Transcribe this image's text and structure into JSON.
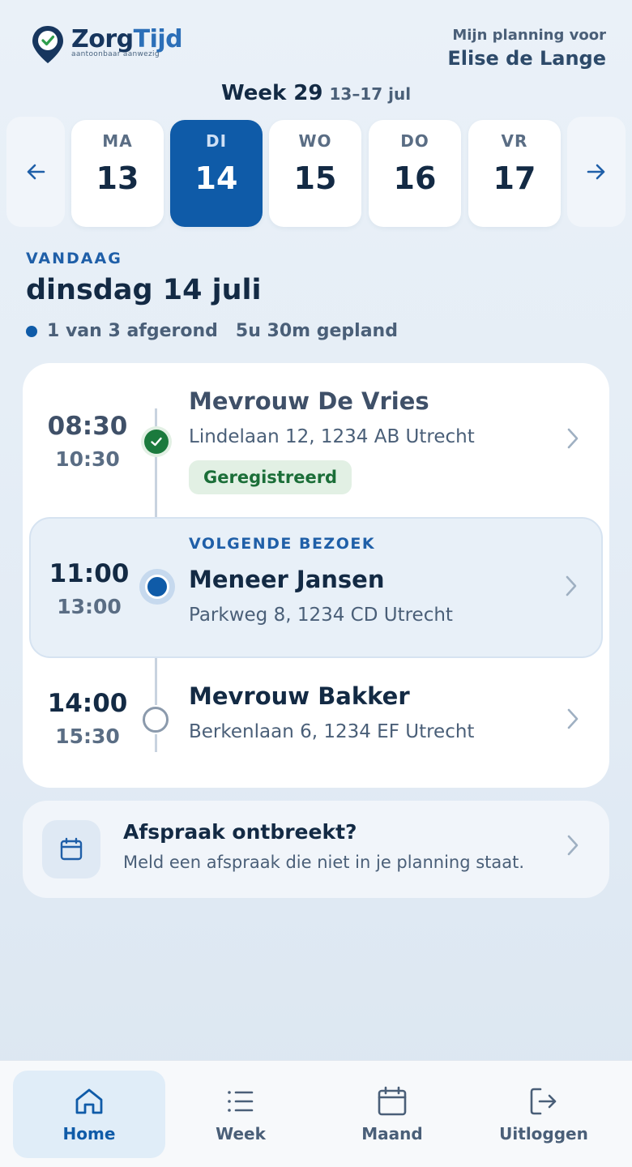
{
  "app": {
    "logo_name_part1": "Zorg",
    "logo_name_part2": "Tijd",
    "logo_tagline": "aantoonbaar aanwezig",
    "planning_label": "Mijn planning voor",
    "user_name": "Elise de Lange"
  },
  "week": {
    "title": "Week 29",
    "range": "13–17 jul",
    "prev_icon": "arrow-left-icon",
    "next_icon": "arrow-right-icon",
    "days": [
      {
        "name": "MA",
        "number": "13",
        "active": false
      },
      {
        "name": "DI",
        "number": "14",
        "active": true
      },
      {
        "name": "WO",
        "number": "15",
        "active": false
      },
      {
        "name": "DO",
        "number": "16",
        "active": false
      },
      {
        "name": "VR",
        "number": "17",
        "active": false
      }
    ]
  },
  "today": {
    "label": "VANDAAG",
    "date": "dinsdag 14 juli",
    "progress": "1 van 3 afgerond",
    "planned": "5u 30m gepland"
  },
  "visits": [
    {
      "start": "08:30",
      "end": "10:30",
      "name": "Mevrouw De Vries",
      "address": "Lindelaan 12, 1234 AB Utrecht",
      "status": "Geregistreerd"
    },
    {
      "label": "VOLGENDE BEZOEK",
      "start": "11:00",
      "end": "13:00",
      "name": "Meneer Jansen",
      "address": "Parkweg 8, 1234 CD Utrecht"
    },
    {
      "start": "14:00",
      "end": "15:30",
      "name": "Mevrouw Bakker",
      "address": "Berkenlaan 6, 1234 EF Utrecht"
    }
  ],
  "missing": {
    "title": "Afspraak ontbreekt?",
    "subtitle": "Meld een afspraak die niet in je planning staat."
  },
  "nav": [
    {
      "label": "Home",
      "icon": "home-icon",
      "active": true
    },
    {
      "label": "Week",
      "icon": "list-icon",
      "active": false
    },
    {
      "label": "Maand",
      "icon": "calendar-icon",
      "active": false
    },
    {
      "label": "Uitloggen",
      "icon": "logout-icon",
      "active": false
    }
  ],
  "colors": {
    "primary": "#0f5ba8",
    "success": "#1b7a3d",
    "text_dark": "#132a44",
    "text_muted": "#4a5f78"
  }
}
